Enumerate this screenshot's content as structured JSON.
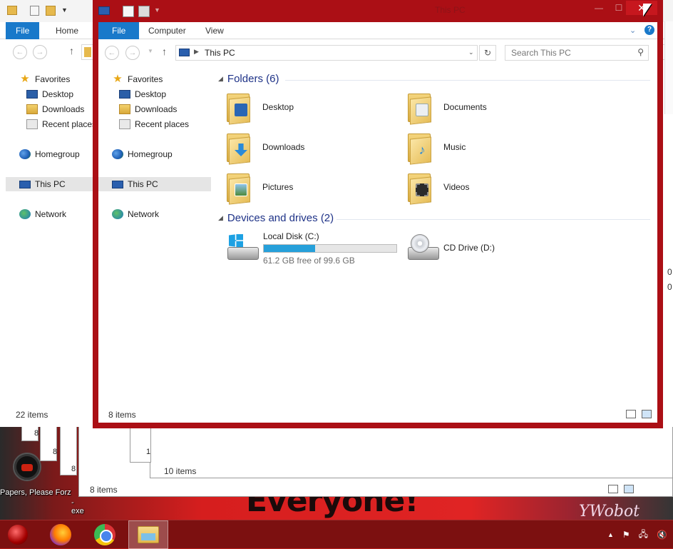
{
  "desktop": {
    "shortcut_label": "Papers, Please Forz",
    "shortcut_label2": "-exe",
    "wallpaper_text": "Everyone!",
    "wallpaper_text2": "YWobot"
  },
  "back_window": {
    "tabs": [
      "File",
      "Home"
    ],
    "sidebar": [
      "Favorites",
      "Desktop",
      "Downloads",
      "Recent places",
      "Homegroup",
      "This PC",
      "Network"
    ],
    "status": "22 items"
  },
  "mid_windows": {
    "status_a": "10 items",
    "status_b": "8 items",
    "tile_nums": [
      "8",
      "8",
      "8",
      "1"
    ]
  },
  "front_window": {
    "title": "This PC",
    "tabs": [
      "File",
      "Computer",
      "View"
    ],
    "address": "This PC",
    "search_placeholder": "Search This PC",
    "sidebar": [
      "Favorites",
      "Desktop",
      "Downloads",
      "Recent places",
      "Homegroup",
      "This PC",
      "Network"
    ],
    "folders_header": "Folders (6)",
    "folders": [
      "Desktop",
      "Documents",
      "Downloads",
      "Music",
      "Pictures",
      "Videos"
    ],
    "drives_header": "Devices and drives (2)",
    "drive_c": {
      "name": "Local Disk (C:)",
      "free": "61.2 GB free of 99.6 GB",
      "used_fraction": 0.386
    },
    "drive_d": {
      "name": "CD Drive (D:)"
    },
    "status": "8 items"
  },
  "edge_digits": [
    "0",
    "0"
  ],
  "colors": {
    "accent": "#1979ca",
    "frame": "#ab0f15",
    "progress": "#26a0da",
    "group_heading": "#1e3287"
  }
}
